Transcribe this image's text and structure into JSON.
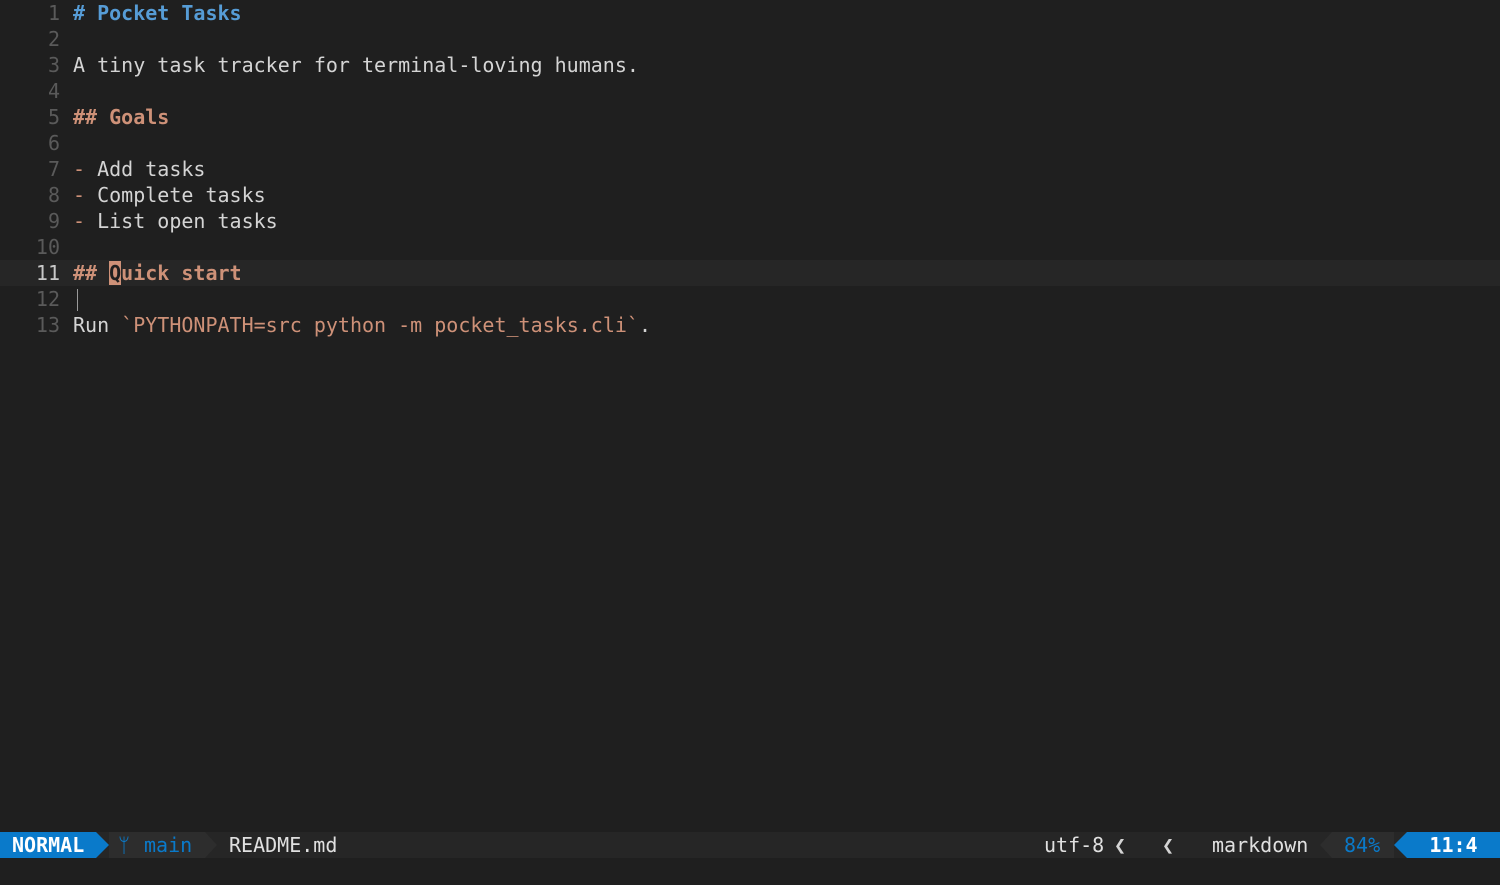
{
  "editor": {
    "lines": [
      {
        "num": "1",
        "parts": [
          {
            "text": "# Pocket Tasks",
            "cls": "h1"
          }
        ]
      },
      {
        "num": "2",
        "parts": []
      },
      {
        "num": "3",
        "parts": [
          {
            "text": "A tiny task tracker for terminal-loving humans.",
            "cls": ""
          }
        ]
      },
      {
        "num": "4",
        "parts": []
      },
      {
        "num": "5",
        "parts": [
          {
            "text": "## Goals",
            "cls": "h2"
          }
        ]
      },
      {
        "num": "6",
        "parts": []
      },
      {
        "num": "7",
        "parts": [
          {
            "text": "- ",
            "cls": "bullet"
          },
          {
            "text": "Add tasks",
            "cls": ""
          }
        ]
      },
      {
        "num": "8",
        "parts": [
          {
            "text": "- ",
            "cls": "bullet"
          },
          {
            "text": "Complete tasks",
            "cls": ""
          }
        ]
      },
      {
        "num": "9",
        "parts": [
          {
            "text": "- ",
            "cls": "bullet"
          },
          {
            "text": "List open tasks",
            "cls": ""
          }
        ]
      },
      {
        "num": "10",
        "parts": []
      },
      {
        "num": "11",
        "current": true,
        "parts": [
          {
            "text": "## ",
            "cls": "h2"
          },
          {
            "text": "Q",
            "cls": "h2 cursor"
          },
          {
            "text": "uick start",
            "cls": "h2"
          }
        ]
      },
      {
        "num": "12",
        "guide": true,
        "parts": []
      },
      {
        "num": "13",
        "parts": [
          {
            "text": "Run ",
            "cls": ""
          },
          {
            "text": "`PYTHONPATH=src python -m pocket_tasks.cli`",
            "cls": "code"
          },
          {
            "text": ".",
            "cls": ""
          }
        ]
      }
    ]
  },
  "statusline": {
    "mode": "NORMAL",
    "branch_icon": "git-branch-icon",
    "branch": "main",
    "filename": "README.md",
    "encoding": "utf-8",
    "os_icon": "linux-icon",
    "filetype_icon": "file-icon",
    "filetype": "markdown",
    "percent": "84%",
    "position": "11:4",
    "separator": "❮"
  },
  "colors": {
    "background": "#1f1f1f",
    "accent": "#0a7aca",
    "heading1": "#569cd6",
    "heading2": "#ce9178"
  }
}
